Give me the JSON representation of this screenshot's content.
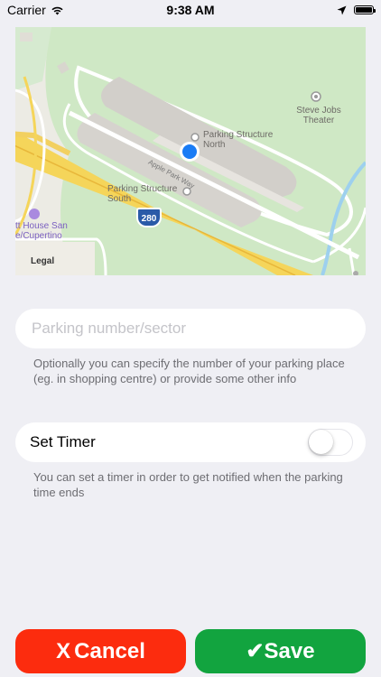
{
  "status_bar": {
    "carrier": "Carrier",
    "time": "9:38 AM"
  },
  "map": {
    "places": [
      {
        "name": "Parking Structure North"
      },
      {
        "name": "Parking Structure South"
      },
      {
        "name": "Steve Jobs Theater"
      }
    ],
    "street": "Apple Park Way",
    "highway_shield": "280",
    "hotel_label_line1": "tt House San",
    "hotel_label_line2": "e/Cupertino",
    "legal": "Legal"
  },
  "parking_field": {
    "placeholder": "Parking number/sector",
    "value": ""
  },
  "parking_hint": "Optionally you can specify the number of your parking place (eg. in shopping centre) or provide some other info",
  "timer": {
    "label": "Set Timer",
    "enabled": false
  },
  "timer_hint": "You can set a timer in order to get notified when the parking time ends",
  "buttons": {
    "cancel_glyph": "X",
    "cancel_label": "Cancel",
    "save_glyph": "✔",
    "save_label": "Save"
  },
  "colors": {
    "background": "#efeff4",
    "cancel": "#fc2c0e",
    "save": "#12a43f",
    "location_dot": "#1a7cf5",
    "highway": "#f5d55a"
  }
}
